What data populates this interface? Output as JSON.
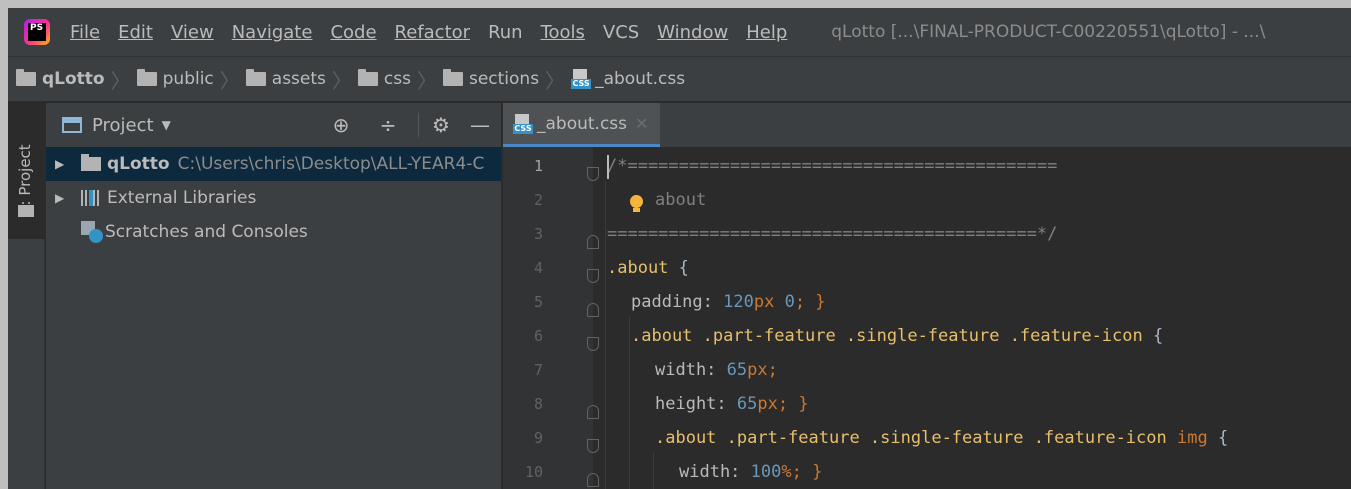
{
  "menubar": {
    "items": [
      "File",
      "Edit",
      "View",
      "Navigate",
      "Code",
      "Refactor",
      "Run",
      "Tools",
      "VCS",
      "Window",
      "Help"
    ],
    "window_title": "qLotto [...\\FINAL-PRODUCT-C00220551\\qLotto] - ...\\"
  },
  "app_logo": "PS",
  "breadcrumb": [
    "qLotto",
    "public",
    "assets",
    "css",
    "sections",
    "_about.css"
  ],
  "toolstrip": {
    "project_tab_label": "1: Project"
  },
  "project_panel": {
    "title": "Project",
    "tree": {
      "root_name": "qLotto",
      "root_path": "C:\\Users\\chris\\Desktop\\ALL-YEAR4-C",
      "external_libraries": "External Libraries",
      "scratches": "Scratches and Consoles"
    }
  },
  "editor": {
    "tab_label": "_about.css",
    "icon_label": "CSS",
    "line_numbers": [
      "1",
      "2",
      "3",
      "4",
      "5",
      "6",
      "7",
      "8",
      "9",
      "10"
    ],
    "lines": {
      "l1": "/*==========================================",
      "l2": "about",
      "l3": "==========================================*/",
      "l4_sel": ".about",
      "l4_brace": " {",
      "l5_prop": "padding: ",
      "l5_num": "120",
      "l5_unit": "px",
      "l5_rest": " 0",
      "l5_end": "; }",
      "l6_sel": ".about .part-feature .single-feature .feature-icon",
      "l6_brace": " {",
      "l7_prop": "width: ",
      "l7_num": "65",
      "l7_unit": "px",
      "l7_end": ";",
      "l8_prop": "height: ",
      "l8_num": "65",
      "l8_unit": "px",
      "l8_end": "; }",
      "l9_sel": ".about .part-feature .single-feature .feature-icon",
      "l9_tag": " img",
      "l9_brace": " {",
      "l10_prop": "width: ",
      "l10_num": "100",
      "l10_unit": "%",
      "l10_end": "; }"
    }
  }
}
